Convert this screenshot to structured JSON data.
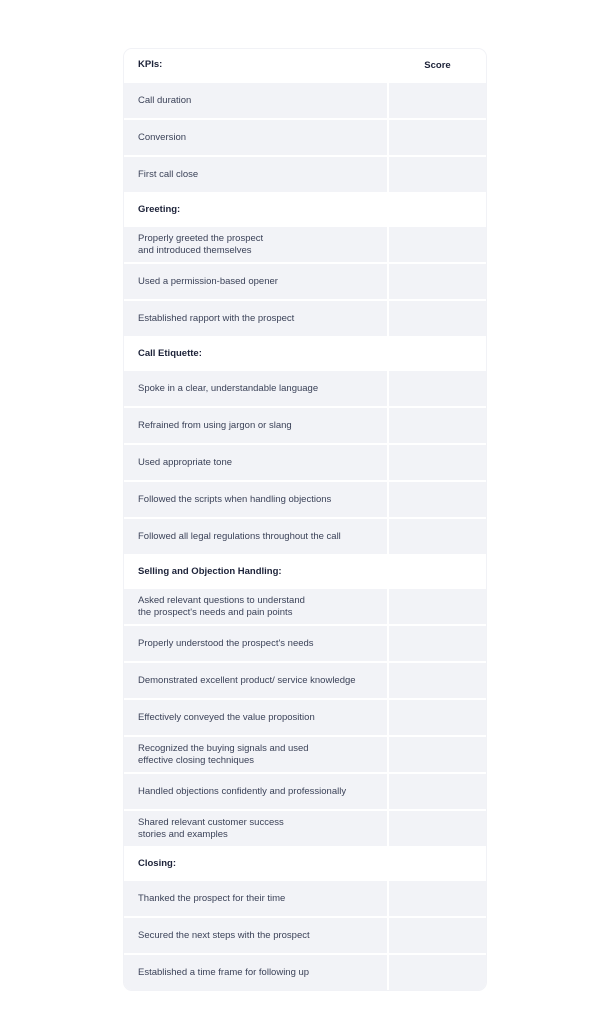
{
  "table": {
    "header": {
      "label": "KPIs:",
      "score": "Score"
    },
    "rows": [
      {
        "type": "item",
        "label": "Call duration",
        "score": ""
      },
      {
        "type": "item",
        "label": "Conversion",
        "score": ""
      },
      {
        "type": "item",
        "label": "First call close",
        "score": ""
      },
      {
        "type": "section",
        "label": "Greeting:",
        "score": ""
      },
      {
        "type": "item",
        "label": "Properly greeted the prospect\nand introduced themselves",
        "score": ""
      },
      {
        "type": "item",
        "label": "Used a permission-based opener",
        "score": ""
      },
      {
        "type": "item",
        "label": "Established rapport with the prospect",
        "score": ""
      },
      {
        "type": "section",
        "label": "Call Etiquette:",
        "score": ""
      },
      {
        "type": "item",
        "label": "Spoke in a clear, understandable language",
        "score": ""
      },
      {
        "type": "item",
        "label": "Refrained from using jargon or slang",
        "score": ""
      },
      {
        "type": "item",
        "label": "Used appropriate tone",
        "score": ""
      },
      {
        "type": "item",
        "label": "Followed the scripts when handling objections",
        "score": ""
      },
      {
        "type": "item",
        "label": "Followed all legal regulations throughout the call",
        "score": ""
      },
      {
        "type": "section",
        "label": "Selling and Objection Handling:",
        "score": ""
      },
      {
        "type": "item",
        "label": "Asked relevant questions to understand\nthe prospect's needs and pain points",
        "score": ""
      },
      {
        "type": "item",
        "label": "Properly understood the prospect's needs",
        "score": ""
      },
      {
        "type": "item",
        "label": "Demonstrated excellent product/ service knowledge",
        "score": ""
      },
      {
        "type": "item",
        "label": "Effectively conveyed the value proposition",
        "score": ""
      },
      {
        "type": "item",
        "label": "Recognized the buying signals and used\neffective closing techniques",
        "score": ""
      },
      {
        "type": "item",
        "label": "Handled objections confidently and professionally",
        "score": ""
      },
      {
        "type": "item",
        "label": "Shared relevant customer success\nstories and examples",
        "score": ""
      },
      {
        "type": "section",
        "label": "Closing:",
        "score": ""
      },
      {
        "type": "item",
        "label": "Thanked the prospect for their time",
        "score": ""
      },
      {
        "type": "item",
        "label": "Secured the next steps with the prospect",
        "score": ""
      },
      {
        "type": "item",
        "label": "Established a time frame for following up",
        "score": ""
      }
    ]
  }
}
